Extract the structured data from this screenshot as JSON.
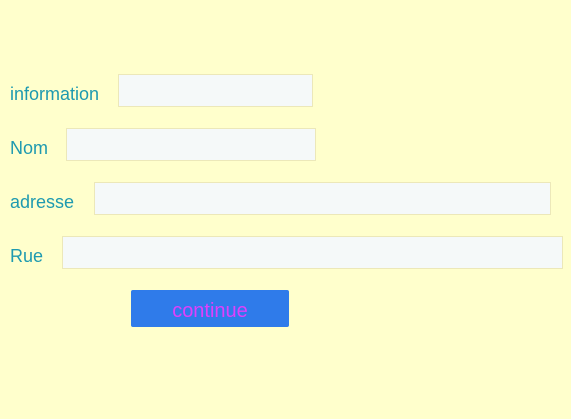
{
  "form": {
    "fields": [
      {
        "label": "information",
        "value": "",
        "placeholder": ""
      },
      {
        "label": "Nom",
        "value": "",
        "placeholder": ""
      },
      {
        "label": "adresse",
        "value": "",
        "placeholder": ""
      },
      {
        "label": "Rue",
        "value": "",
        "placeholder": ""
      }
    ],
    "continue_label": "continue"
  },
  "colors": {
    "background": "#ffffcc",
    "label_text": "#1e9ab0",
    "input_background": "#f5f9f9",
    "input_border": "#ece8b9",
    "button_background": "#2f7bea",
    "button_text": "#e040fb"
  }
}
